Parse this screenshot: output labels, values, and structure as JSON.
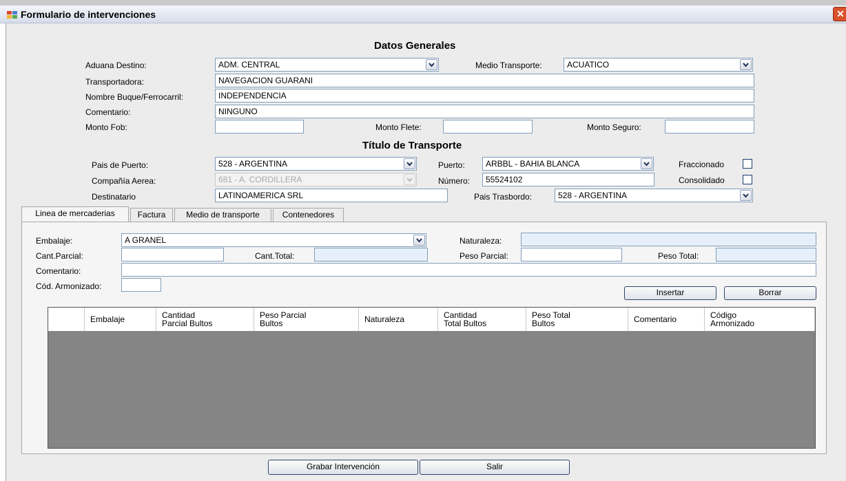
{
  "window": {
    "title": "Formulario de intervenciones",
    "close_glyph": "✕"
  },
  "datos_generales": {
    "section_title": "Datos Generales",
    "aduana_destino": {
      "label": "Aduana Destino:",
      "value": "ADM. CENTRAL"
    },
    "medio_transporte": {
      "label": "Medio Transporte:",
      "value": "ACUATICO"
    },
    "transportadora": {
      "label": "Transportadora:",
      "value": "NAVEGACION GUARANI"
    },
    "nombre_buque": {
      "label": "Nombre Buque/Ferrocarril:",
      "value": "INDEPENDENCIA"
    },
    "comentario": {
      "label": "Comentario:",
      "value": "NINGUNO"
    },
    "monto_fob": {
      "label": "Monto Fob:",
      "value": ""
    },
    "monto_flete": {
      "label": "Monto Flete:",
      "value": ""
    },
    "monto_seguro": {
      "label": "Monto Seguro:",
      "value": ""
    }
  },
  "titulo_transporte": {
    "section_title": "Título de Transporte",
    "pais_puerto": {
      "label": "Pais de Puerto:",
      "value": "528 - ARGENTINA"
    },
    "puerto": {
      "label": "Puerto:",
      "value": "ARBBL - BAHIA BLANCA"
    },
    "fraccionado": {
      "label": "Fraccionado",
      "checked": false
    },
    "compania_aerea": {
      "label": "Compañía Aerea:",
      "value": "681 - A. CORDILLERA"
    },
    "numero": {
      "label": "Número:",
      "value": "55524102"
    },
    "consolidado": {
      "label": "Consolidado",
      "checked": false
    },
    "destinatario": {
      "label": "Destinatario",
      "value": "LATINOAMERICA SRL"
    },
    "pais_trasbordo": {
      "label": "Pais Trasbordo:",
      "value": "528 - ARGENTINA"
    }
  },
  "tabs": [
    {
      "label": "Linea de mercaderias",
      "active": true
    },
    {
      "label": "Factura",
      "active": false
    },
    {
      "label": "Medio de transporte",
      "active": false
    },
    {
      "label": "Contenedores",
      "active": false
    }
  ],
  "mercaderias": {
    "embalaje": {
      "label": "Embalaje:",
      "value": "A GRANEL"
    },
    "naturaleza": {
      "label": "Naturaleza:",
      "value": ""
    },
    "cant_parcial": {
      "label": "Cant.Parcial:",
      "value": ""
    },
    "cant_total": {
      "label": "Cant.Total:",
      "value": ""
    },
    "peso_parcial": {
      "label": "Peso Parcial:",
      "value": ""
    },
    "peso_total": {
      "label": "Peso Total:",
      "value": ""
    },
    "comentario": {
      "label": "Comentario:",
      "value": ""
    },
    "cod_armonizado": {
      "label": "Cód. Armonizado:",
      "value": ""
    },
    "insertar_label": "Insertar",
    "borrar_label": "Borrar",
    "columns": [
      [
        "Embalaje",
        ""
      ],
      [
        "Cantidad",
        "Parcial Bultos"
      ],
      [
        "Peso Parcial",
        "Bultos"
      ],
      [
        "Naturaleza",
        ""
      ],
      [
        "Cantidad",
        "Total Bultos"
      ],
      [
        "Peso Total",
        "Bultos"
      ],
      [
        "Comentario",
        ""
      ],
      [
        "Código",
        "Armonizado"
      ]
    ]
  },
  "footer": {
    "grabar_label": "Grabar Intervención",
    "salir_label": "Salir"
  },
  "colors": {
    "readonly_field": "#e7f0fa",
    "grid_empty": "#858585",
    "close_button": "#d9512c"
  }
}
